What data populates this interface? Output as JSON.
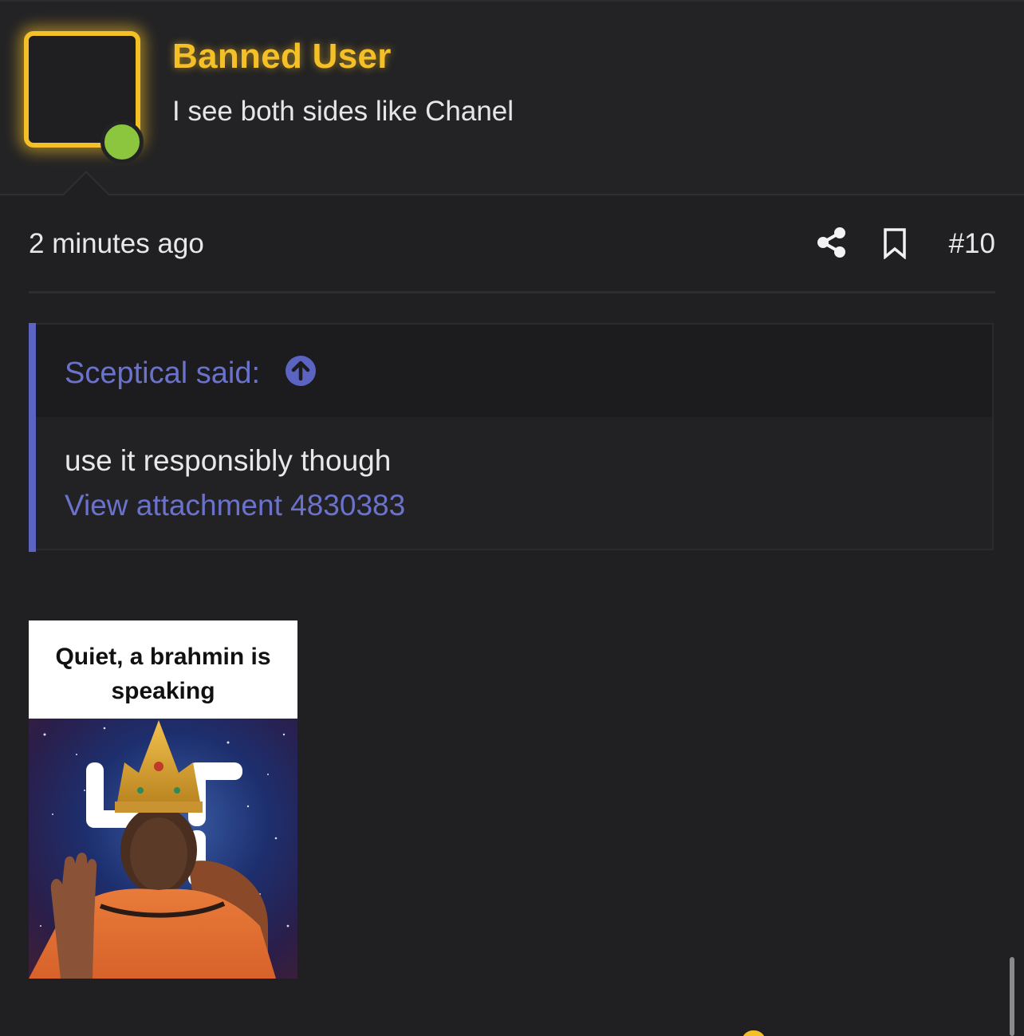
{
  "post": {
    "author": {
      "name": "Banned User",
      "title": "I see both sides like Chanel",
      "status": "online",
      "accent_color": "#f5c027",
      "status_color": "#8cc63f"
    },
    "timestamp": "2 minutes ago",
    "actions": {
      "share_icon": "share-icon",
      "bookmark_icon": "bookmark-icon"
    },
    "number": "#10",
    "quote": {
      "author_label": "Sceptical said:",
      "jump_icon": "arrow-up-circle-icon",
      "text": "use it responsibly though",
      "link_text": "View attachment 4830383",
      "accent_color": "#5c64c2"
    },
    "attachment": {
      "caption": "Quiet, a brahmin is speaking"
    }
  }
}
